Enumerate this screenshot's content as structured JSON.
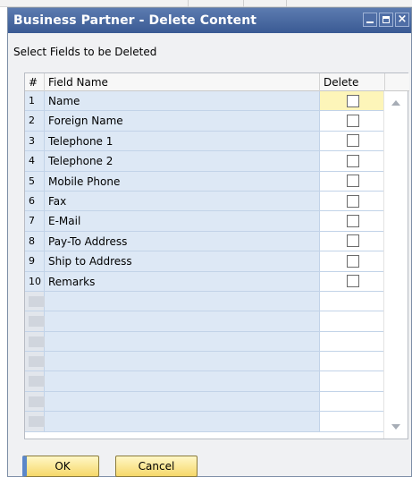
{
  "window": {
    "title": "Business Partner - Delete Content"
  },
  "subtitle": "Select Fields to be Deleted",
  "table": {
    "headers": {
      "num": "#",
      "field_name": "Field Name",
      "delete": "Delete"
    },
    "rows": [
      {
        "num": "1",
        "name": "Name"
      },
      {
        "num": "2",
        "name": "Foreign Name"
      },
      {
        "num": "3",
        "name": "Telephone 1"
      },
      {
        "num": "4",
        "name": "Telephone 2"
      },
      {
        "num": "5",
        "name": "Mobile Phone"
      },
      {
        "num": "6",
        "name": "Fax"
      },
      {
        "num": "7",
        "name": "E-Mail"
      },
      {
        "num": "8",
        "name": "Pay-To Address"
      },
      {
        "num": "9",
        "name": "Ship to Address"
      },
      {
        "num": "10",
        "name": "Remarks"
      }
    ],
    "empty_rows": 7
  },
  "buttons": {
    "ok": "OK",
    "cancel": "Cancel"
  },
  "icons": {
    "minimize": "minimize-icon",
    "maximize": "maximize-icon",
    "close": "close-icon",
    "scroll_up": "arrow-up-icon",
    "scroll_down": "arrow-down-icon"
  },
  "colors": {
    "title_bar": "#3a5a94",
    "row_bg": "#dde8f5",
    "selected_cell": "#fdf5b9",
    "button": "#f6d86a"
  }
}
